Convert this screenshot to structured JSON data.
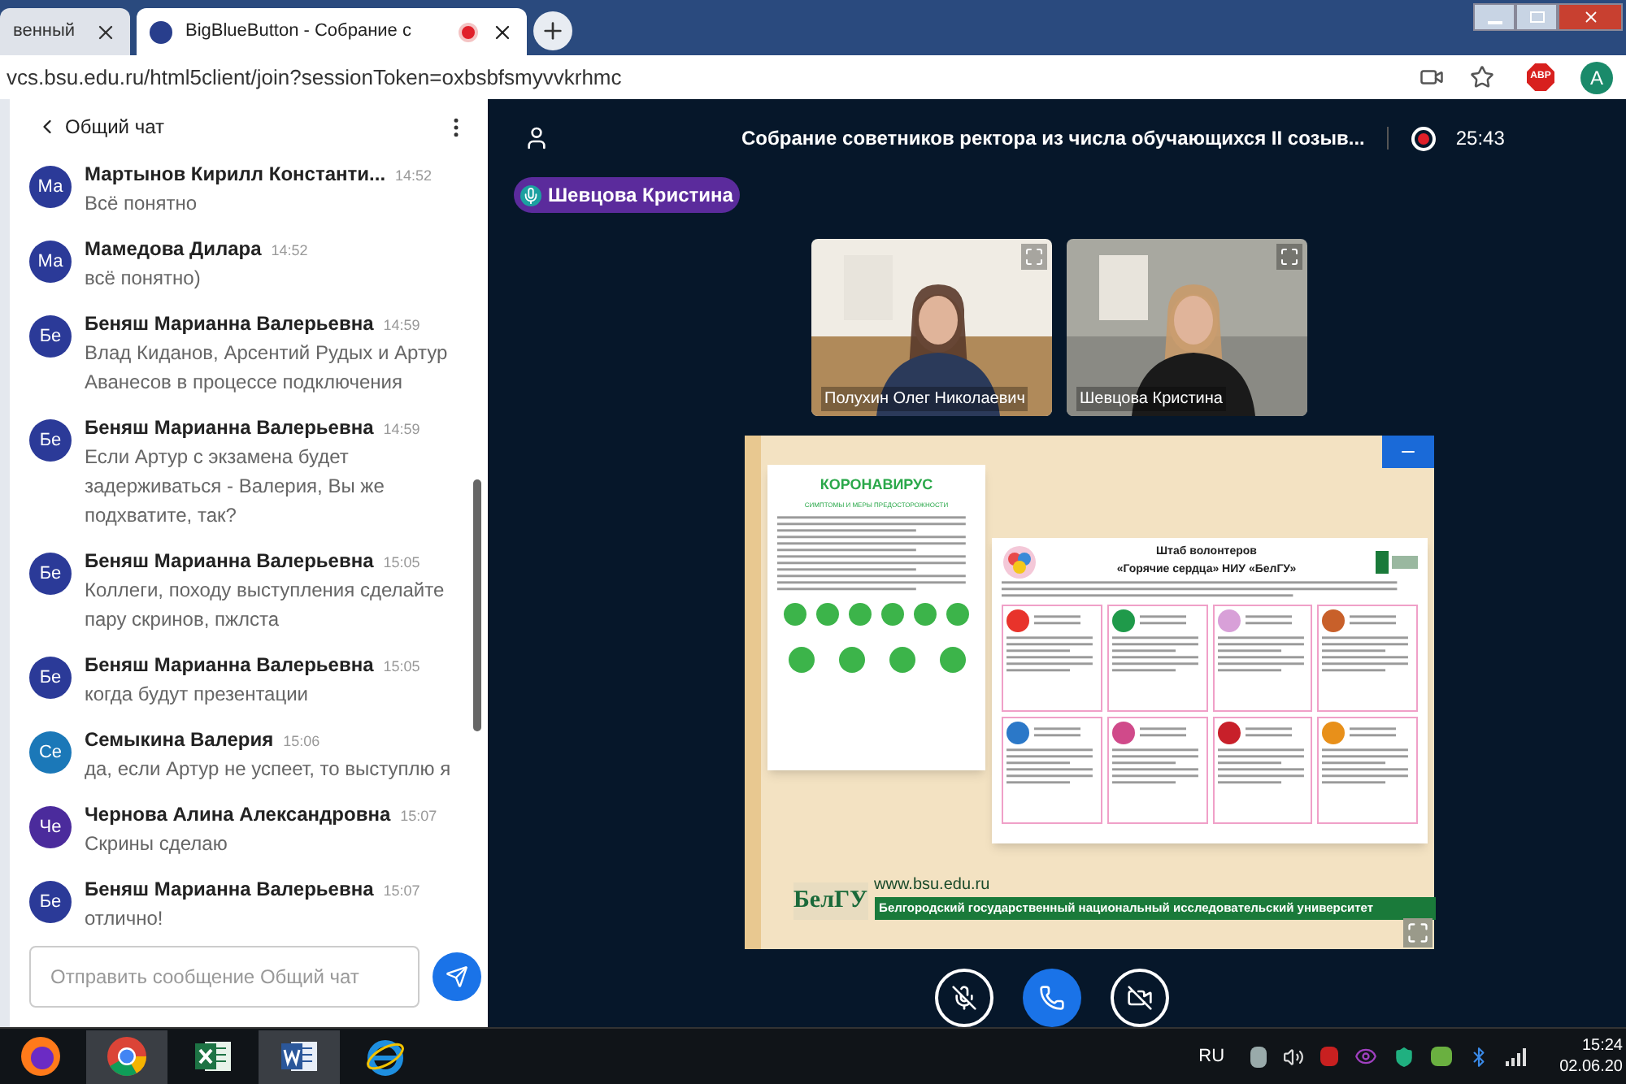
{
  "browser": {
    "tabs": [
      {
        "title": "венный",
        "selected": false
      },
      {
        "title": "BigBlueButton - Собрание с",
        "selected": true,
        "recording": true
      }
    ],
    "address": "vcs.bsu.edu.ru/html5client/join?sessionToken=oxbsbfsmyvvkrhmc",
    "extension": "ABP",
    "profile": "A"
  },
  "chat": {
    "title": "Общий чат",
    "messages": [
      {
        "initials": "Ма",
        "color": "#2b3a98",
        "name": "Мартынов Кирилл Константи...",
        "time": "14:52",
        "text": "Всё понятно"
      },
      {
        "initials": "Ма",
        "color": "#2b3a98",
        "name": "Мамедова Дилара",
        "time": "14:52",
        "text": "всё понятно)"
      },
      {
        "initials": "Бе",
        "color": "#2b3a98",
        "name": "Беняш Марианна Валерьевна",
        "time": "14:59",
        "text": "Влад Киданов, Арсентий Рудых и Артур Аванесов в процессе подключения"
      },
      {
        "initials": "Бе",
        "color": "#2b3a98",
        "name": "Беняш Марианна Валерьевна",
        "time": "14:59",
        "text": "Если Артур с экзамена будет задерживаться - Валерия, Вы же подхватите, так?"
      },
      {
        "initials": "Бе",
        "color": "#2b3a98",
        "name": "Беняш Марианна Валерьевна",
        "time": "15:05",
        "text": "Коллеги, походу выступления сделайте пару скринов, пжлста"
      },
      {
        "initials": "Бе",
        "color": "#2b3a98",
        "name": "Беняш Марианна Валерьевна",
        "time": "15:05",
        "text": "когда будут презентации"
      },
      {
        "initials": "Се",
        "color": "#1b78b8",
        "name": "Семыкина Валерия",
        "time": "15:06",
        "text": "да, если Артур не успеет, то выступлю я"
      },
      {
        "initials": "Че",
        "color": "#4b2b9c",
        "name": "Чернова Алина Александровна",
        "time": "15:07",
        "text": "Скрины сделаю"
      },
      {
        "initials": "Бе",
        "color": "#2b3a98",
        "name": "Беняш Марианна Валерьевна",
        "time": "15:07",
        "text": "отлично!"
      }
    ],
    "input": {
      "placeholder": "Отправить сообщение Общий чат"
    }
  },
  "meeting": {
    "title": "Собрание советников ректора из числа обучающихся II созыв...",
    "recording": true,
    "timer": "25:43",
    "talking": "Шевцова Кристина",
    "videos": [
      {
        "name": "Полухин Олег Николаевич"
      },
      {
        "name": "Шевцова Кристина"
      }
    ],
    "slide": {
      "poster_title": "КОРОНАВИРУС",
      "poster_subtitle": "СИМПТОМЫ И МЕРЫ ПРЕДОСТОРОЖНОСТИ",
      "headquarters_title": "Штаб волонтеров",
      "headquarters_subtitle": "«Горячие сердца» НИУ «БелГУ»",
      "logo": "БелГУ",
      "url": "www.bsu.edu.ru",
      "university": "Белгородский государственный национальный исследовательский университет"
    },
    "controls": {
      "muted": true,
      "camera_off": true
    }
  },
  "taskbar": {
    "apps": [
      {
        "kind": "firefox",
        "selected": false
      },
      {
        "kind": "chrome",
        "selected": true
      },
      {
        "kind": "excel",
        "selected": false
      },
      {
        "kind": "word",
        "selected": true
      },
      {
        "kind": "ie",
        "selected": false
      }
    ],
    "language": "RU",
    "time": "15:24",
    "date": "02.06.20"
  }
}
